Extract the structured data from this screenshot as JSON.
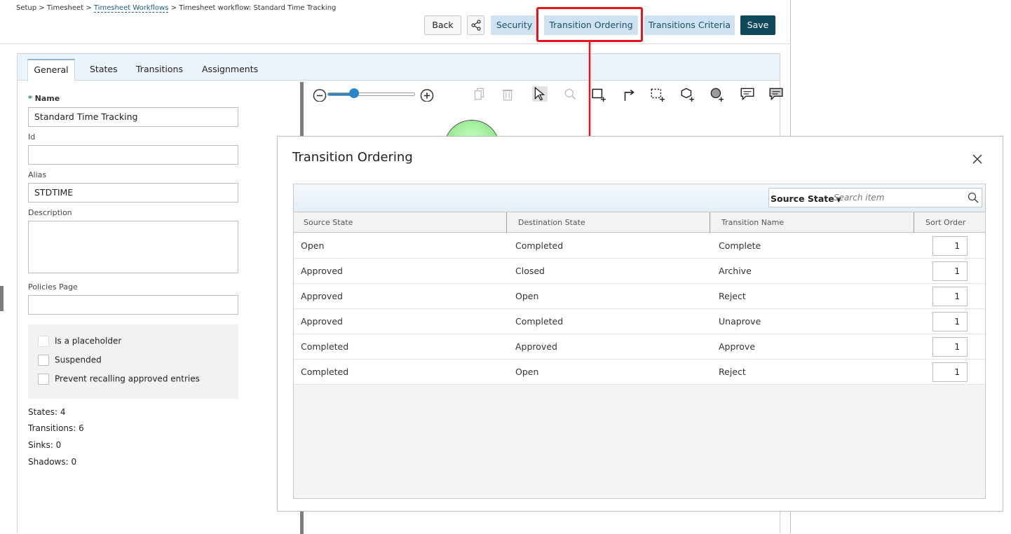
{
  "breadcrumb": {
    "setup": "Setup",
    "timesheet": "Timesheet",
    "workflows": "Timesheet Workflows",
    "current": "Timesheet workflow: Standard Time Tracking",
    "separator": ">"
  },
  "toolbar": {
    "back": "Back",
    "security": "Security",
    "transition_ordering": "Transition Ordering",
    "transitions_criteria": "Transitions Criteria",
    "save": "Save"
  },
  "tabs": {
    "general": "General",
    "states": "States",
    "transitions": "Transitions",
    "assignments": "Assignments"
  },
  "form": {
    "required_marker": "*",
    "name_label": "Name",
    "name_value": "Standard Time Tracking",
    "id_label": "Id",
    "id_value": "",
    "alias_label": "Alias",
    "alias_value": "STDTIME",
    "description_label": "Description",
    "description_value": "",
    "policies_label": "Policies Page",
    "policies_value": "",
    "checkboxes": {
      "placeholder": "Is a placeholder",
      "suspended": "Suspended",
      "prevent_recall": "Prevent recalling approved entries"
    }
  },
  "stats": {
    "states": "States: 4",
    "transitions": "Transitions: 6",
    "sinks": "Sinks: 0",
    "shadows": "Shadows: 0"
  },
  "modal": {
    "title": "Transition Ordering",
    "search": {
      "field": "Source State",
      "placeholder": "Search item"
    },
    "columns": {
      "source": "Source State",
      "destination": "Destination State",
      "name": "Transition Name",
      "sort": "Sort Order"
    },
    "rows": [
      {
        "source": "Open",
        "destination": "Completed",
        "name": "Complete",
        "sort": "1"
      },
      {
        "source": "Approved",
        "destination": "Closed",
        "name": "Archive",
        "sort": "1"
      },
      {
        "source": "Approved",
        "destination": "Open",
        "name": "Reject",
        "sort": "1"
      },
      {
        "source": "Approved",
        "destination": "Completed",
        "name": "Unaprove",
        "sort": "1"
      },
      {
        "source": "Completed",
        "destination": "Approved",
        "name": "Approve",
        "sort": "1"
      },
      {
        "source": "Completed",
        "destination": "Open",
        "name": "Reject",
        "sort": "1"
      }
    ]
  },
  "colors": {
    "accent": "#0f4a5c",
    "light_button": "#cfe2f1",
    "highlight": "#e8141c",
    "node": "#6bd96a"
  },
  "zoom_level": 0.3
}
